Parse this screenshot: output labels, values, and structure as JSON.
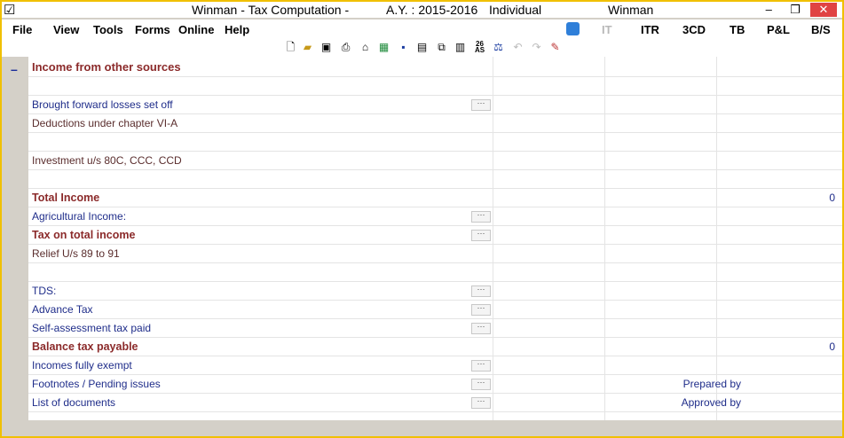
{
  "window": {
    "app": "Winman",
    "title_center": "Winman - Tax Computation -",
    "assessment_year": "A.Y. : 2015-2016",
    "status": "Individual",
    "title_right": "Winman",
    "checkbox_glyph": "☑",
    "minimize": "–",
    "restore": "❐",
    "close": "✕"
  },
  "menu": {
    "items": [
      {
        "label": "File"
      },
      {
        "label": "View"
      },
      {
        "label": "Tools"
      },
      {
        "label": "Forms"
      },
      {
        "label": "Online"
      },
      {
        "label": "Help"
      }
    ],
    "right_items": [
      {
        "label": "IT"
      },
      {
        "label": "ITR"
      },
      {
        "label": "3CD"
      },
      {
        "label": "TB"
      },
      {
        "label": "P&L"
      },
      {
        "label": "B/S"
      }
    ]
  },
  "toolbar": {
    "icons": [
      "new-file-icon",
      "open-folder-icon",
      "save-icon",
      "print-icon",
      "home-icon",
      "excel-icon",
      "lock-icon",
      "import-icon",
      "copy-icon",
      "calculator-icon",
      "26as-icon",
      "balance-icon",
      "undo-icon",
      "redo-icon",
      "tool-icon"
    ]
  },
  "section": {
    "collapse_glyph": "–",
    "title": "Income from other sources"
  },
  "rows": [
    {
      "label": "Brought forward losses set off",
      "dots": "···"
    },
    {
      "label": "Deductions under chapter VI-A"
    },
    {
      "label": "Investment u/s 80C, CCC, CCD"
    },
    {
      "label": "Total Income",
      "value": "0"
    },
    {
      "label": "Agricultural Income:",
      "dots": "···"
    },
    {
      "label": "Tax on total income",
      "dots": "···"
    },
    {
      "label": "Relief U/s 89 to 91"
    },
    {
      "label": "TDS:",
      "dots": "···"
    },
    {
      "label": "Advance Tax",
      "dots": "···"
    },
    {
      "label": "Self-assessment tax paid",
      "dots": "···"
    },
    {
      "label": "Balance tax payable",
      "value": "0"
    },
    {
      "label": "Incomes fully exempt",
      "dots": "···"
    },
    {
      "label": "Footnotes / Pending issues",
      "dots": "···",
      "extra": "Prepared by"
    },
    {
      "label": "List of documents",
      "dots": "···",
      "extra": "Approved by"
    }
  ]
}
